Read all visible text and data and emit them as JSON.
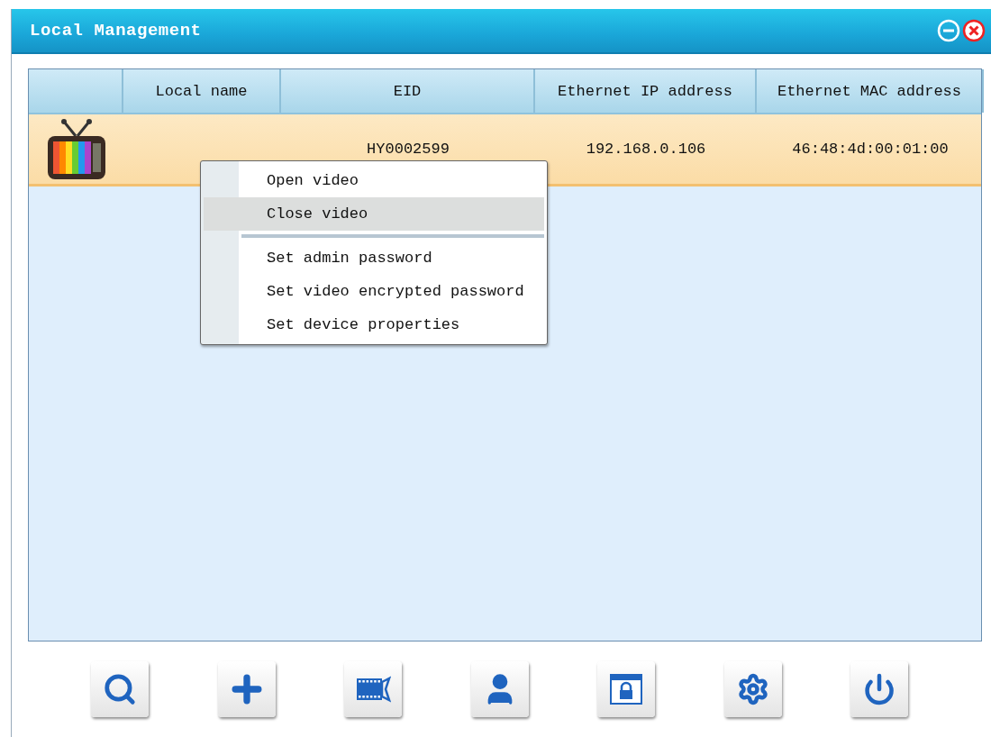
{
  "window": {
    "title": "Local Management"
  },
  "table": {
    "columns": [
      "",
      "Local name",
      "EID",
      "Ethernet IP address",
      "Ethernet MAC address"
    ],
    "rows": [
      {
        "selected": true,
        "cells": [
          "",
          "",
          "HY0002599",
          "192.168.0.106",
          "46:48:4d:00:01:00"
        ]
      }
    ]
  },
  "context_menu": [
    {
      "kind": "item",
      "label": "Open video",
      "selected": false
    },
    {
      "kind": "item",
      "label": "Close video",
      "selected": true
    },
    {
      "kind": "separator"
    },
    {
      "kind": "item",
      "label": "Set admin password",
      "selected": false
    },
    {
      "kind": "item",
      "label": "Set video encrypted password",
      "selected": false
    },
    {
      "kind": "item",
      "label": "Set device properties",
      "selected": false
    }
  ],
  "toolbar": [
    {
      "kind": "search"
    },
    {
      "kind": "add"
    },
    {
      "kind": "video"
    },
    {
      "kind": "user"
    },
    {
      "kind": "lock"
    },
    {
      "kind": "settings"
    },
    {
      "kind": "power"
    }
  ]
}
